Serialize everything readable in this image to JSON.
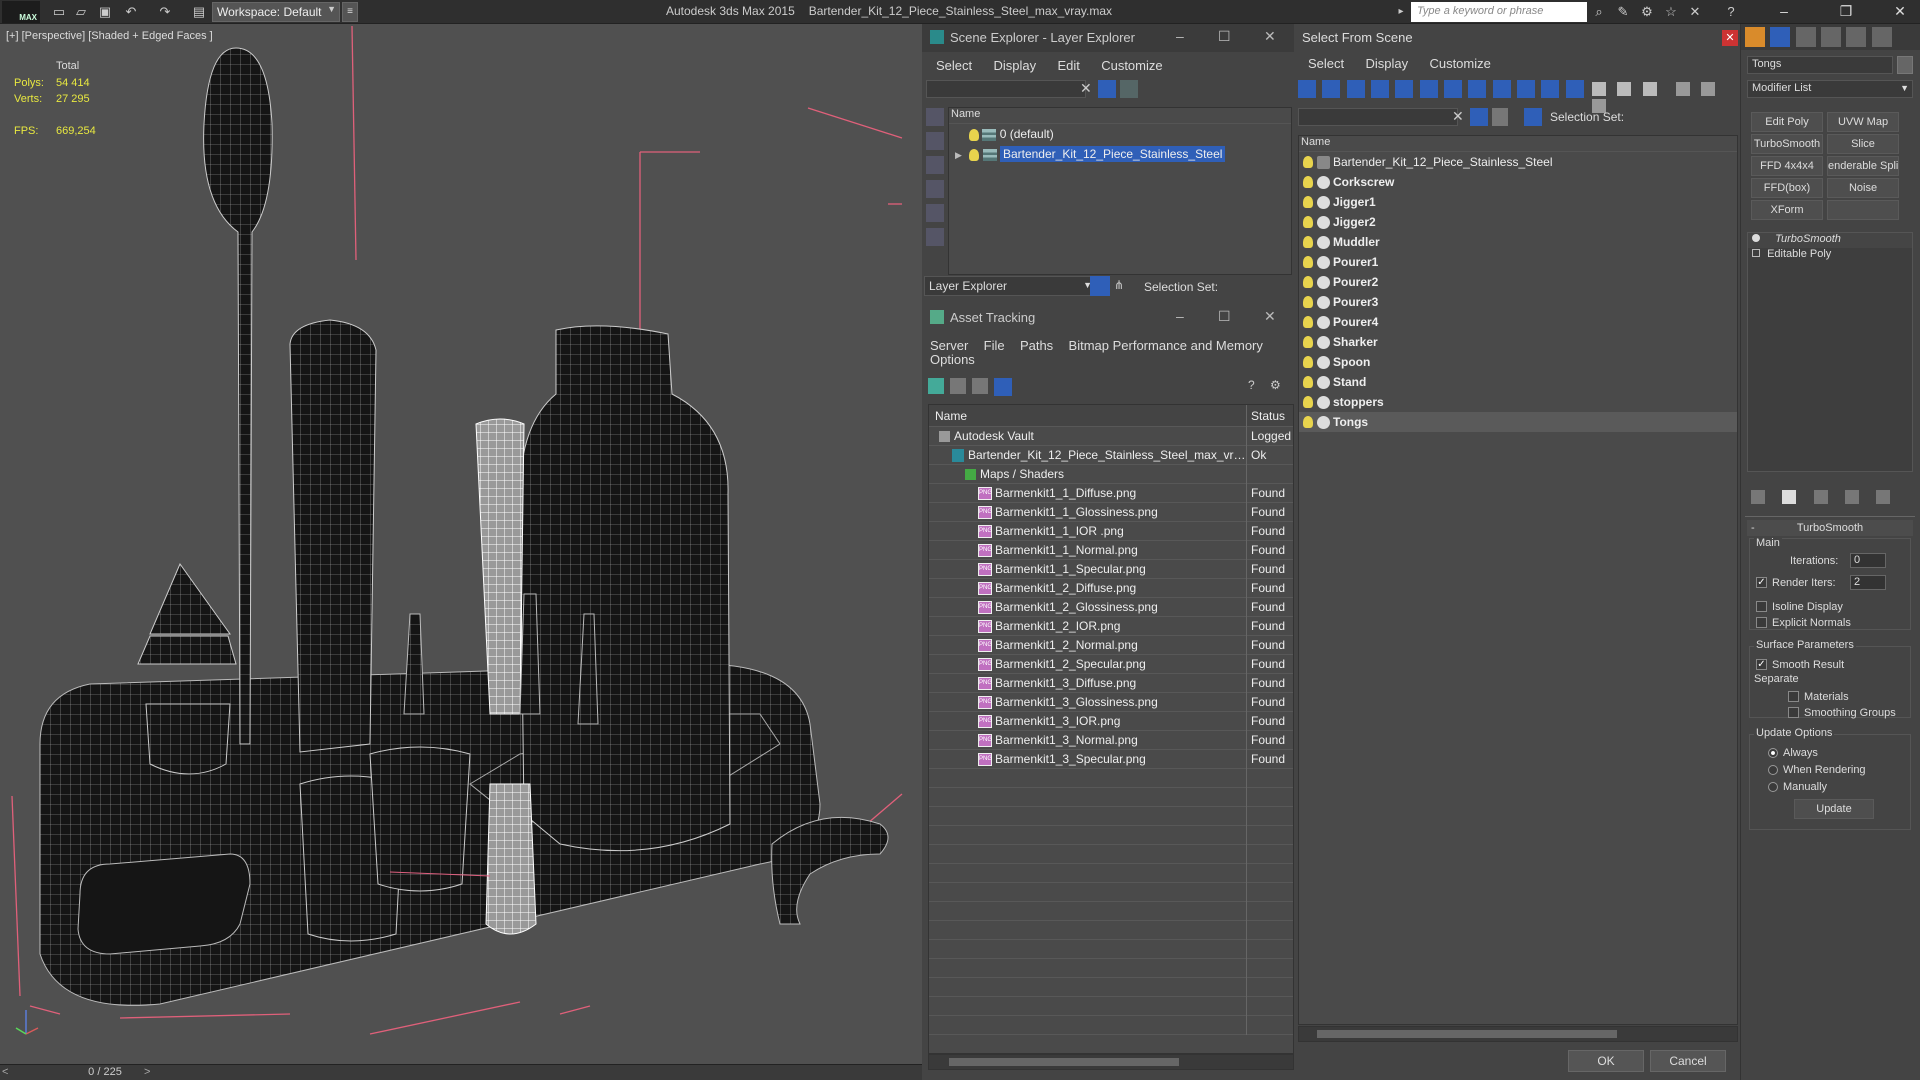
{
  "titlebar": {
    "logo": "MAX",
    "workspace": "Workspace: Default",
    "app_name": "Autodesk 3ds Max  2015",
    "file_name": "Bartender_Kit_12_Piece_Stainless_Steel_max_vray.max",
    "search_placeholder": "Type a keyword or phrase"
  },
  "viewport": {
    "label": "[+] [Perspective] [Shaded + Edged Faces ]",
    "total_label": "Total",
    "polys_label": "Polys:",
    "polys_value": "54 414",
    "verts_label": "Verts:",
    "verts_value": "27 295",
    "fps_label": "FPS:",
    "fps_value": "669,254"
  },
  "timeslider": {
    "value": "0 / 225"
  },
  "scene_explorer": {
    "title": "Scene Explorer - Layer Explorer",
    "menu": [
      "Select",
      "Display",
      "Edit",
      "Customize"
    ],
    "column_name": "Name",
    "layers": [
      {
        "label": "0 (default)",
        "selected": false
      },
      {
        "label": "Bartender_Kit_12_Piece_Stainless_Steel",
        "selected": true
      }
    ],
    "footer_dropdown": "Layer Explorer",
    "selection_set_label": "Selection Set:"
  },
  "asset_tracking": {
    "title": "Asset Tracking",
    "menu": [
      "Server",
      "File",
      "Paths",
      "Bitmap Performance and Memory"
    ],
    "menu2": [
      "Options"
    ],
    "col_name": "Name",
    "col_status": "Status",
    "rows": [
      {
        "name": "Autodesk Vault",
        "status": "Logged",
        "indent": 0,
        "kind": "vault"
      },
      {
        "name": "Bartender_Kit_12_Piece_Stainless_Steel_max_vra...",
        "status": "Ok",
        "indent": 1,
        "kind": "max"
      },
      {
        "name": "Maps / Shaders",
        "status": "",
        "indent": 2,
        "kind": "folder"
      },
      {
        "name": "Barmenkit1_1_Diffuse.png",
        "status": "Found",
        "indent": 3,
        "kind": "png"
      },
      {
        "name": "Barmenkit1_1_Glossiness.png",
        "status": "Found",
        "indent": 3,
        "kind": "png"
      },
      {
        "name": "Barmenkit1_1_IOR .png",
        "status": "Found",
        "indent": 3,
        "kind": "png"
      },
      {
        "name": "Barmenkit1_1_Normal.png",
        "status": "Found",
        "indent": 3,
        "kind": "png"
      },
      {
        "name": "Barmenkit1_1_Specular.png",
        "status": "Found",
        "indent": 3,
        "kind": "png"
      },
      {
        "name": "Barmenkit1_2_Diffuse.png",
        "status": "Found",
        "indent": 3,
        "kind": "png"
      },
      {
        "name": "Barmenkit1_2_Glossiness.png",
        "status": "Found",
        "indent": 3,
        "kind": "png"
      },
      {
        "name": "Barmenkit1_2_IOR.png",
        "status": "Found",
        "indent": 3,
        "kind": "png"
      },
      {
        "name": "Barmenkit1_2_Normal.png",
        "status": "Found",
        "indent": 3,
        "kind": "png"
      },
      {
        "name": "Barmenkit1_2_Specular.png",
        "status": "Found",
        "indent": 3,
        "kind": "png"
      },
      {
        "name": "Barmenkit1_3_Diffuse.png",
        "status": "Found",
        "indent": 3,
        "kind": "png"
      },
      {
        "name": "Barmenkit1_3_Glossiness.png",
        "status": "Found",
        "indent": 3,
        "kind": "png"
      },
      {
        "name": "Barmenkit1_3_IOR.png",
        "status": "Found",
        "indent": 3,
        "kind": "png"
      },
      {
        "name": "Barmenkit1_3_Normal.png",
        "status": "Found",
        "indent": 3,
        "kind": "png"
      },
      {
        "name": "Barmenkit1_3_Specular.png",
        "status": "Found",
        "indent": 3,
        "kind": "png"
      }
    ]
  },
  "select_from_scene": {
    "title": "Select From Scene",
    "menu": [
      "Select",
      "Display",
      "Customize"
    ],
    "selection_set_label": "Selection Set:",
    "column_name": "Name",
    "root": "Bartender_Kit_12_Piece_Stainless_Steel",
    "objects": [
      "Corkscrew",
      "Jigger1",
      "Jigger2",
      "Muddler",
      "Pourer1",
      "Pourer2",
      "Pourer3",
      "Pourer4",
      "Sharker",
      "Spoon",
      "Stand",
      "stoppers",
      "Tongs"
    ],
    "selected_object": "Tongs",
    "ok_label": "OK",
    "cancel_label": "Cancel"
  },
  "command_panel": {
    "object_name": "Tongs",
    "modifier_list": "Modifier List",
    "buttons": [
      "Edit Poly",
      "UVW Map",
      "TurboSmooth",
      "Slice",
      "FFD 4x4x4",
      "enderable Splin",
      "FFD(box)",
      "Noise",
      "XForm",
      ""
    ],
    "stack": [
      "TurboSmooth",
      "Editable Poly"
    ],
    "rollout_title": "TurboSmooth",
    "main_label": "Main",
    "iterations_label": "Iterations:",
    "iterations_value": "0",
    "render_iters_label": "Render Iters:",
    "render_iters_value": "2",
    "isoline_label": "Isoline Display",
    "explicit_normals_label": "Explicit Normals",
    "surface_params_label": "Surface Parameters",
    "smooth_result_label": "Smooth Result",
    "separate_label": "Separate",
    "materials_label": "Materials",
    "smoothing_groups_label": "Smoothing Groups",
    "update_options_label": "Update Options",
    "always_label": "Always",
    "when_rendering_label": "When Rendering",
    "manually_label": "Manually",
    "update_button": "Update"
  },
  "colors": {
    "selection_blue": "#2f5fb8",
    "bulb_yellow": "#e8d44d",
    "stats_yellow": "#e8e840",
    "viewport_bg": "#505050"
  }
}
